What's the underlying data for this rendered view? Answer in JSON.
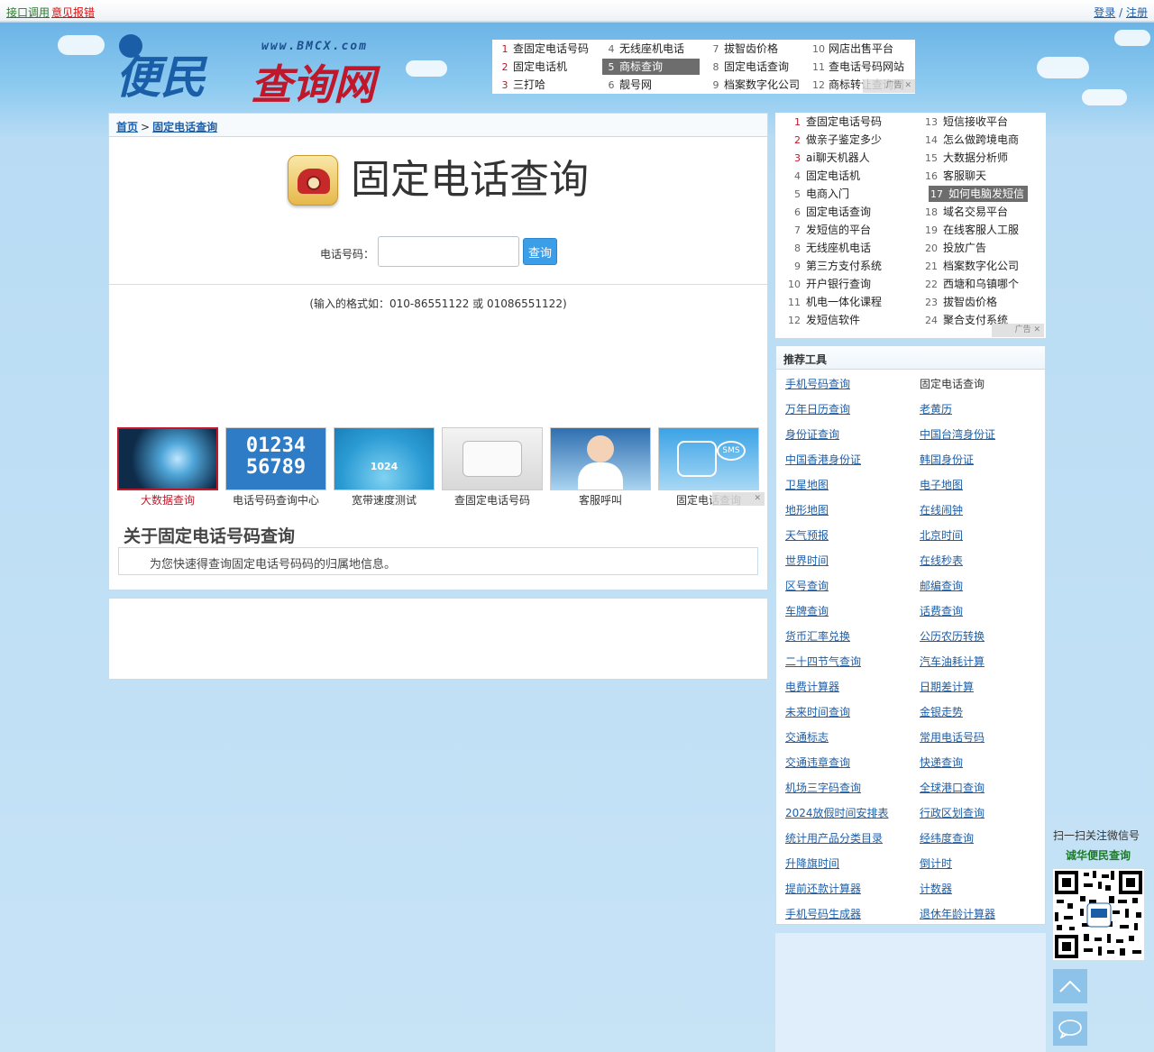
{
  "topbar": {
    "api": "接口调用",
    "report": "意见报错",
    "login": "登录",
    "slash": " / ",
    "register": "注册"
  },
  "logo": {
    "site": "www.BMCX.com",
    "part1": "便民",
    "part2": "查询网"
  },
  "header_ad": {
    "items": [
      {
        "n": "1",
        "text": "查固定电话号码"
      },
      {
        "n": "2",
        "text": "固定电话机"
      },
      {
        "n": "3",
        "text": "三打哈"
      },
      {
        "n": "4",
        "text": "无线座机电话"
      },
      {
        "n": "5",
        "text": "商标查询"
      },
      {
        "n": "6",
        "text": "靓号网"
      },
      {
        "n": "7",
        "text": "拔智齿价格"
      },
      {
        "n": "8",
        "text": "固定电话查询"
      },
      {
        "n": "9",
        "text": "档案数字化公司"
      },
      {
        "n": "10",
        "text": "网店出售平台"
      },
      {
        "n": "11",
        "text": "查电话号码网站"
      },
      {
        "n": "12",
        "text": "商标转让查询网"
      }
    ],
    "tag": "广告"
  },
  "breadcrumb": {
    "home": "首页",
    "sep": ">",
    "current": "固定电话查询"
  },
  "main": {
    "title": "固定电话查询",
    "phone_label": "电话号码：",
    "phone_value": "",
    "query_button": "查询",
    "hint": "(输入的格式如：010-86551122 或 01086551122)",
    "about_title": "关于固定电话号码查询",
    "about_text": "为您快速得查询固定电话号码码的归属地信息。"
  },
  "thumbs": [
    {
      "caption": "大数据查询",
      "img": ""
    },
    {
      "caption": "电话号码查询中心",
      "img": "01234\n56789"
    },
    {
      "caption": "宽带速度测试",
      "img": "1024"
    },
    {
      "caption": "查固定电话号码",
      "img": ""
    },
    {
      "caption": "客服呼叫",
      "img": ""
    },
    {
      "caption": "固定电话查询",
      "img": "SMS"
    }
  ],
  "right_ad": {
    "items": [
      {
        "n": "1",
        "text": "查固定电话号码"
      },
      {
        "n": "2",
        "text": "做亲子鉴定多少"
      },
      {
        "n": "3",
        "text": "ai聊天机器人"
      },
      {
        "n": "4",
        "text": "固定电话机"
      },
      {
        "n": "5",
        "text": "电商入门"
      },
      {
        "n": "6",
        "text": "固定电话查询"
      },
      {
        "n": "7",
        "text": "发短信的平台"
      },
      {
        "n": "8",
        "text": "无线座机电话"
      },
      {
        "n": "9",
        "text": "第三方支付系统"
      },
      {
        "n": "10",
        "text": "开户银行查询"
      },
      {
        "n": "11",
        "text": "机电一体化课程"
      },
      {
        "n": "12",
        "text": "发短信软件"
      },
      {
        "n": "13",
        "text": "短信接收平台"
      },
      {
        "n": "14",
        "text": "怎么做跨境电商"
      },
      {
        "n": "15",
        "text": "大数据分析师"
      },
      {
        "n": "16",
        "text": "客服聊天"
      },
      {
        "n": "17",
        "text": "如何电脑发短信"
      },
      {
        "n": "18",
        "text": "域名交易平台"
      },
      {
        "n": "19",
        "text": "在线客服人工服"
      },
      {
        "n": "20",
        "text": "投放广告"
      },
      {
        "n": "21",
        "text": "档案数字化公司"
      },
      {
        "n": "22",
        "text": "西塘和乌镇哪个"
      },
      {
        "n": "23",
        "text": "拔智齿价格"
      },
      {
        "n": "24",
        "text": "聚合支付系统"
      }
    ],
    "tag": "广告"
  },
  "tools": {
    "title": "推荐工具",
    "left": [
      "手机号码查询",
      "万年日历查询",
      "身份证查询",
      "中国香港身份证",
      "卫星地图",
      "地形地图",
      "天气预报",
      "世界时间",
      "区号查询",
      "车牌查询",
      "货币汇率兑换",
      "二十四节气查询",
      "电费计算器",
      "未来时间查询",
      "交通标志",
      "交通违章查询",
      "机场三字码查询",
      "2024放假时间安排表",
      "统计用产品分类目录",
      "升降旗时间",
      "提前还款计算器",
      "手机号码生成器"
    ],
    "right": [
      "固定电话查询",
      "老黄历",
      "中国台湾身份证",
      "韩国身份证",
      "电子地图",
      "在线闹钟",
      "北京时间",
      "在线秒表",
      "邮编查询",
      "话费查询",
      "公历农历转换",
      "汽车油耗计算",
      "日期差计算",
      "金银走势",
      "常用电话号码",
      "快递查询",
      "全球港口查询",
      "行政区划查询",
      "经纬度查询",
      "倒计时",
      "计数器",
      "退休年龄计算器"
    ]
  },
  "qr": {
    "title": "扫一扫关注微信号",
    "name": "诚华便民查询"
  },
  "colors": {
    "accent": "#1d5ea8",
    "brand_red": "#c0172a",
    "border": "#c5dcee",
    "button": "#3d9ee8"
  }
}
